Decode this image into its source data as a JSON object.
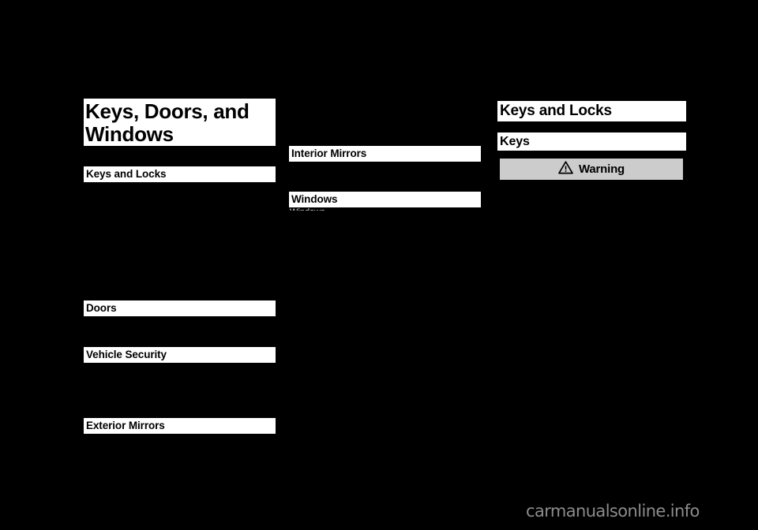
{
  "page": {
    "background_color": "#000000",
    "text_color": "#ffffff",
    "bar_background": "#ffffff",
    "bar_text_color": "#000000"
  },
  "chapter": {
    "title": "Keys, Doors, and\nWindows"
  },
  "columns": {
    "left": {
      "headings": [
        {
          "label": "Keys and Locks"
        },
        {
          "label": "Doors"
        },
        {
          "label": "Vehicle Security"
        },
        {
          "label": "Exterior Mirrors"
        }
      ]
    },
    "middle": {
      "headings": [
        {
          "label": "Interior Mirrors"
        },
        {
          "label": "Windows"
        }
      ],
      "clipped_text": "Windows"
    },
    "right": {
      "section_title": "Keys and Locks",
      "subsection_title": "Keys",
      "warning": {
        "icon": "warning-triangle-icon",
        "label": "Warning",
        "background_color": "#cccccc",
        "border_color": "#000000"
      }
    }
  },
  "watermark": {
    "text": "carmanualsonline.info",
    "color": "#8c8c8c"
  }
}
